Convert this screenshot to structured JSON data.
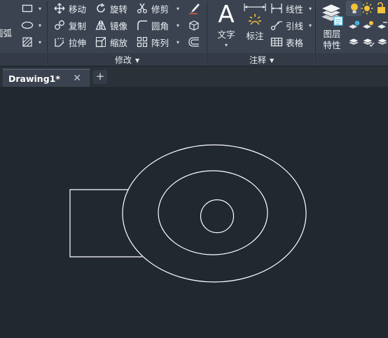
{
  "ribbon": {
    "draw_partial_label": "圆弧",
    "modify": {
      "title": "修改",
      "items": {
        "move": "移动",
        "rotate": "旋转",
        "trim": "修剪",
        "copy": "复制",
        "mirror": "镜像",
        "fillet": "圆角",
        "stretch": "拉伸",
        "scale": "缩放",
        "array": "阵列"
      }
    },
    "annotation": {
      "title": "注释",
      "text": "文字",
      "dimension": "标注",
      "linear": "线性",
      "leader": "引线",
      "table": "表格"
    },
    "layers": {
      "properties": "图层特性"
    }
  },
  "tabs": [
    {
      "label": "Drawing1*",
      "close": "✕"
    }
  ],
  "new_tab": "+",
  "colors": {
    "ribbon_bg": "#3b4350",
    "canvas_bg": "#212830",
    "geometry": "#ffffff",
    "accent_yellow": "#f2c23c",
    "accent_cyan": "#41b3e0"
  },
  "drawing": {
    "entities": [
      "rectangle",
      "outer-ellipse",
      "middle-ellipse",
      "inner-circle"
    ]
  }
}
